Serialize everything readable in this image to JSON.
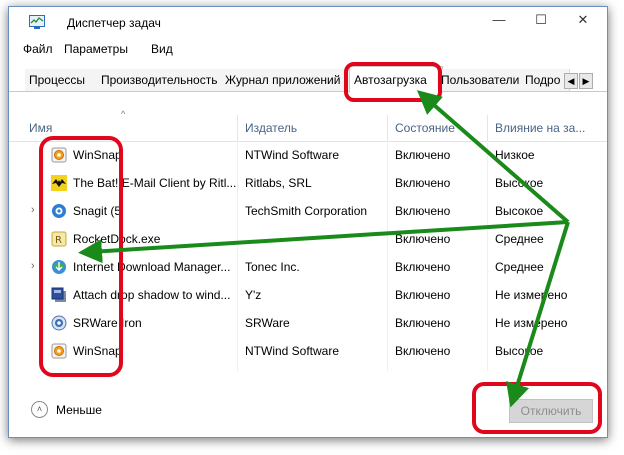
{
  "window": {
    "title": "Диспетчер задач",
    "controls": {
      "minimize": "—",
      "maximize": "☐",
      "close": "✕"
    }
  },
  "menu": [
    "Файл",
    "Параметры",
    "Вид"
  ],
  "tabs": [
    {
      "label": "Процессы",
      "active": false
    },
    {
      "label": "Производительность",
      "active": false
    },
    {
      "label": "Журнал приложений",
      "active": false
    },
    {
      "label": "Автозагрузка",
      "active": true
    },
    {
      "label": "Пользователи",
      "active": false
    },
    {
      "label": "Подро",
      "active": false
    }
  ],
  "tab_scroll": {
    "left": "◀",
    "right": "▶"
  },
  "sort_indicator": "^",
  "columns": {
    "name": "Имя",
    "publisher": "Издатель",
    "status": "Состояние",
    "impact": "Влияние на за..."
  },
  "rows": [
    {
      "name": "WinSnap",
      "publisher": "NTWind Software",
      "status": "Включено",
      "impact": "Низкое",
      "icon": "winsnap-icon",
      "expandable": false
    },
    {
      "name": "The Bat! E-Mail Client by Ritl...",
      "publisher": "Ritlabs, SRL",
      "status": "Включено",
      "impact": "Высокое",
      "icon": "thebat-icon",
      "expandable": false
    },
    {
      "name": "Snagit (5",
      "publisher": "TechSmith Corporation",
      "status": "Включено",
      "impact": "Высокое",
      "icon": "snagit-icon",
      "expandable": true
    },
    {
      "name": "RocketDock.exe",
      "publisher": "",
      "status": "Включено",
      "impact": "Среднее",
      "icon": "rocketdock-icon",
      "expandable": false
    },
    {
      "name": "Internet Download Manager...",
      "publisher": "Tonec Inc.",
      "status": "Включено",
      "impact": "Среднее",
      "icon": "idm-icon",
      "expandable": true
    },
    {
      "name": "Attach drop shadow to wind...",
      "publisher": "Y'z",
      "status": "Включено",
      "impact": "Не измерено",
      "icon": "dropshadow-icon",
      "expandable": false
    },
    {
      "name": "SRWare Iron",
      "publisher": "SRWare",
      "status": "Включено",
      "impact": "Не измерено",
      "icon": "srware-iron-icon",
      "expandable": false
    },
    {
      "name": "WinSnap",
      "publisher": "NTWind Software",
      "status": "Включено",
      "impact": "Высокое",
      "icon": "winsnap-icon",
      "expandable": false
    }
  ],
  "footer": {
    "less_label": "Меньше",
    "less_icon": "˄",
    "disable_button": "Отключить"
  },
  "annotation": {
    "highlight_color": "#e0061c",
    "arrow_color": "#1a8a1a"
  }
}
